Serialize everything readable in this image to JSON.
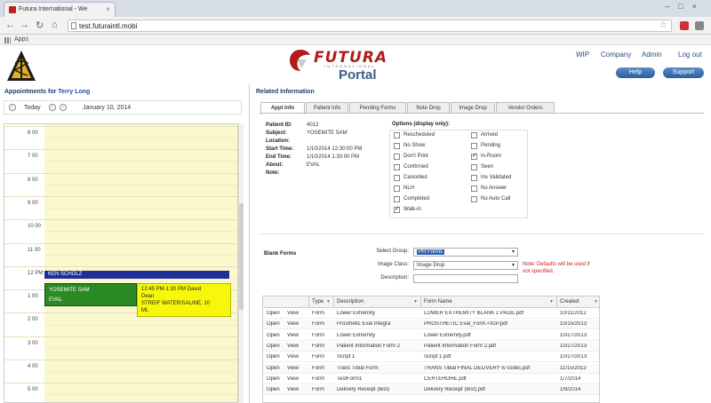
{
  "browser": {
    "tab_title": "Futura International - We",
    "url": "test.futuraintl.mobi",
    "bookmarks_label": "Apps"
  },
  "header": {
    "logo_name": "FUTURA",
    "logo_sub": "INTERNATIONAL",
    "portal": "Portal",
    "nav": [
      "WIP",
      "Company",
      "Admin",
      "Log out"
    ],
    "btn_help": "Help",
    "btn_support": "Support"
  },
  "left": {
    "title": "Appointments for",
    "user": "Terry Long",
    "today_label": "Today",
    "date": "January 10, 2014",
    "times": [
      "6 00",
      "7 00",
      "8 00",
      "9 00",
      "10 00",
      "11 00",
      "12 PM",
      "1 00",
      "2 00",
      "3 00",
      "4 00",
      "5 00"
    ],
    "event_blue": "KEN SCHOLZ",
    "event_green_l1": "YOSEMITE SAM",
    "event_green_l2": "EVAL",
    "event_yellow_l1": "12:45 PM-1:30 PM David",
    "event_yellow_l2": "Dean",
    "event_yellow_l3": "STREIF WATER/SALINE, 10",
    "event_yellow_l4": "ML"
  },
  "right": {
    "title": "Related Information",
    "tabs": [
      "Appt Info",
      "Patient Info",
      "Pending Forms",
      "Note Drop",
      "Image Drop",
      "Vendor Orders"
    ],
    "info_labels": [
      "Patient ID:",
      "Subject:",
      "Location:",
      "Start Time:",
      "End Time:",
      "About:",
      "Note:"
    ],
    "info_values": [
      "4012",
      "YOSEMITE SAM",
      "",
      "1/10/2014 12:30:00 PM",
      "1/10/2014 1:30:00 PM",
      "EVAL",
      ""
    ],
    "options_title": "Options (display only):",
    "options_left": [
      {
        "label": "Rescheduled",
        "checked": false
      },
      {
        "label": "No Show",
        "checked": false
      },
      {
        "label": "Don't Print",
        "checked": false
      },
      {
        "label": "Confirmed",
        "checked": false
      },
      {
        "label": "Cancelled",
        "checked": false
      },
      {
        "label": "NLH",
        "checked": false
      },
      {
        "label": "Completed",
        "checked": false
      },
      {
        "label": "Walk-in",
        "checked": true
      }
    ],
    "options_right": [
      {
        "label": "Arrived",
        "checked": false
      },
      {
        "label": "Pending",
        "checked": false
      },
      {
        "label": "In-Room",
        "checked": true
      },
      {
        "label": "Seen",
        "checked": false
      },
      {
        "label": "Ins Validated",
        "checked": false
      },
      {
        "label": "No Answer",
        "checked": false
      },
      {
        "label": "No Auto Call",
        "checked": false
      }
    ],
    "blank_forms": "Blank Forms",
    "select_group_label": "Select Group:",
    "select_group_value": "PH Forms",
    "image_class_label": "Image Class:",
    "image_class_value": "Image Drop",
    "description_label": "Description:",
    "description_value": "",
    "note": "Note: Defaults will be used if not specified.",
    "table": {
      "headers": [
        "",
        "Type",
        "Description",
        "Form Name",
        "Created"
      ],
      "open": "Open",
      "view": "View",
      "rows": [
        [
          "Form",
          "Lower Extremity",
          "LOWER EXTREMITY BLANK 2 PAGE.pdf",
          "10/11/2012"
        ],
        [
          "Form",
          "Prosthetic Eval Integra",
          "PROSTHETIC Eval_Form.<IGP.pdf",
          "10/15/2013"
        ],
        [
          "Form",
          "Lower Extremity",
          "Lower Extremity.pdf",
          "10/27/2013"
        ],
        [
          "Form",
          "Patient Information Form 2",
          "Patient Information Form 2.pdf",
          "10/27/2013"
        ],
        [
          "Form",
          "Script 1",
          "Script 1.pdf",
          "10/27/2013"
        ],
        [
          "Form",
          "Trans Tibial Form",
          "TRANS Tibial FINAL DELIVERY w codes.pdf",
          "11/15/2013"
        ],
        [
          "Form",
          "TestForm1",
          "CERTEHORE.pdf",
          "1/7/2014"
        ],
        [
          "Form",
          "Delivery Receipt (test)",
          "Delivery Receipt (test).pdf",
          "1/9/2014"
        ]
      ]
    }
  }
}
